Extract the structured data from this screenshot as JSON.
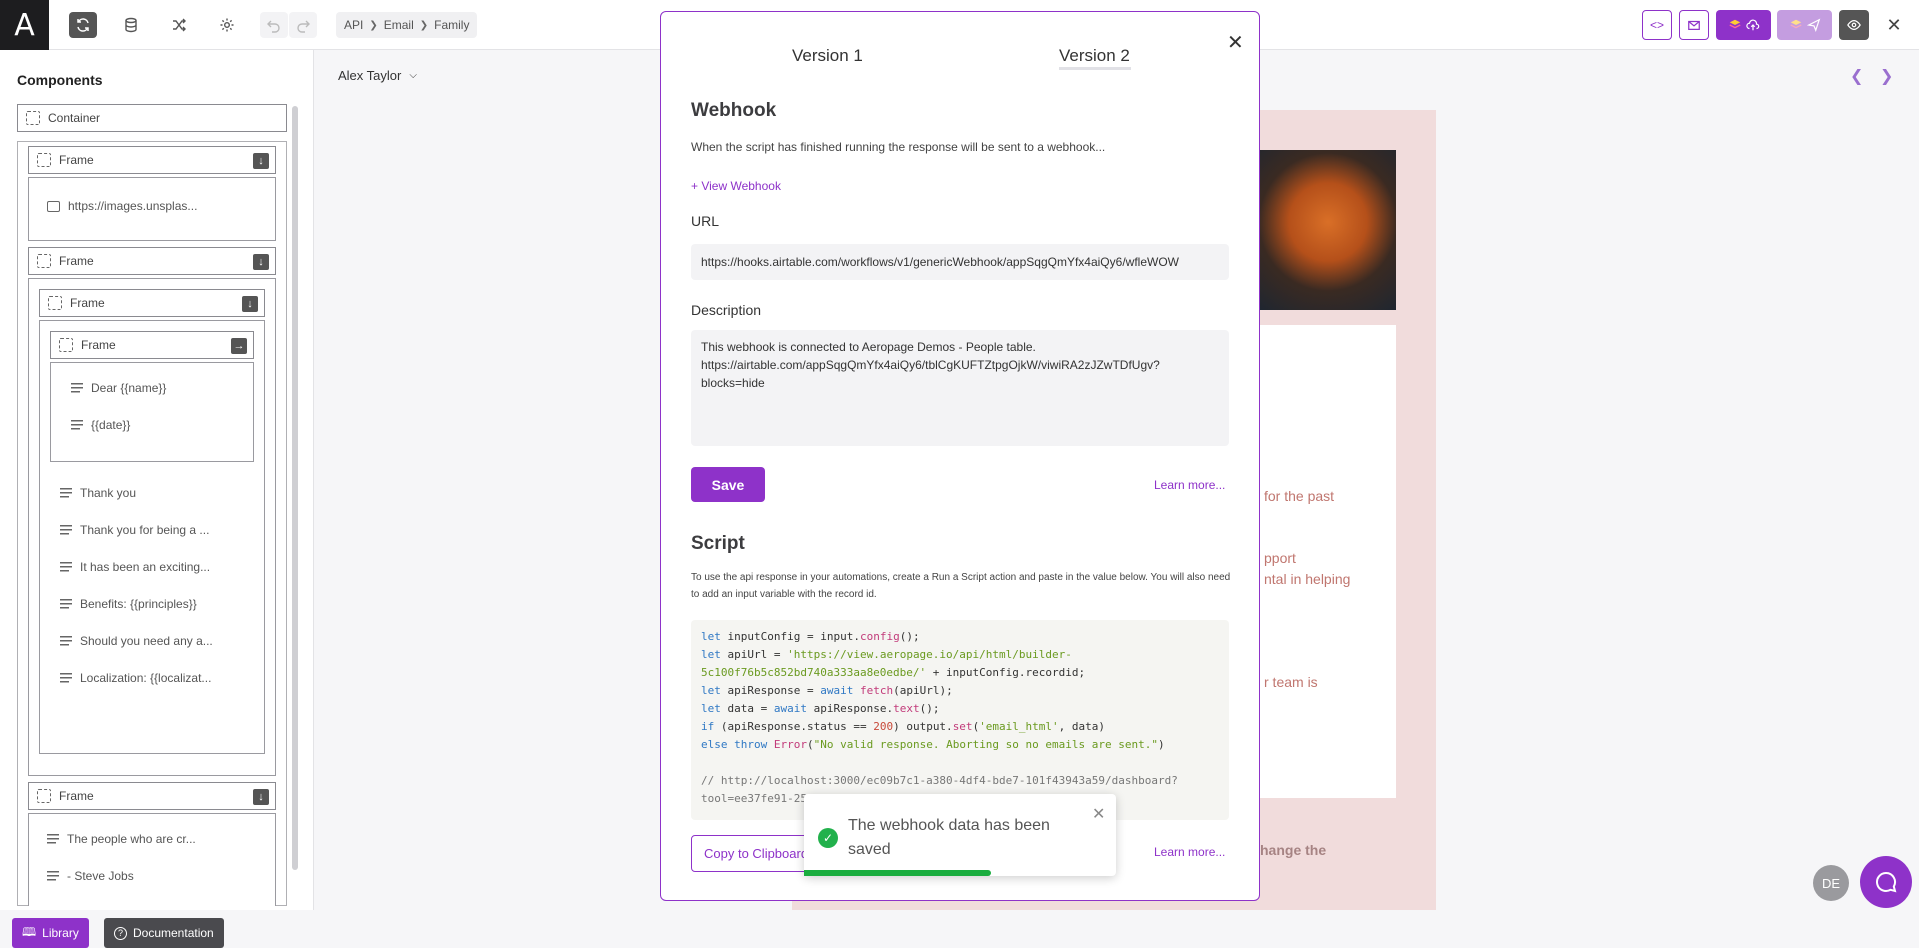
{
  "topbar": {
    "logo_icon": "aeropage-logo-icon",
    "breadcrumb": [
      "API",
      "Email",
      "Family"
    ]
  },
  "left_panel": {
    "title": "Components",
    "tree": {
      "container": "Container",
      "frame1": "Frame",
      "image": "https://images.unsplas...",
      "frame2": "Frame",
      "frame3": "Frame",
      "frame4": "Frame",
      "dear": "Dear {{name}}",
      "date": "{{date}}",
      "items": [
        "Thank you",
        "Thank you for being a ...",
        "It has been an exciting...",
        "Benefits: {{principles}}",
        "Should you need any a...",
        "Localization: {{localizat..."
      ],
      "frame5": "Frame",
      "people": "The people who are cr...",
      "jobs": "- Steve Jobs"
    },
    "library_label": "Library",
    "documentation_label": "Documentation"
  },
  "user_dropdown": "Alex Taylor",
  "preview": {
    "text1": "for the past",
    "text2": "pport",
    "text3": "ntal in helping",
    "text4": "r team is",
    "bottom": "hange the"
  },
  "modal": {
    "tab1": "Version 1",
    "tab2": "Version 2",
    "webhook_title": "Webhook",
    "webhook_desc": "When the script has finished running the response will be sent to a webhook...",
    "view_webhook": "+ View Webhook",
    "url_label": "URL",
    "url_value": "https://hooks.airtable.com/workflows/v1/genericWebhook/appSqgQmYfx4aiQy6/wfleWOW",
    "desc_label": "Description",
    "desc_value": "This webhook is connected to Aeropage Demos - People table.\nhttps://airtable.com/appSqgQmYfx4aiQy6/tblCgKUFTZtpgOjkW/viwiRA2zJZwTDfUgv?\nblocks=hide",
    "save_label": "Save",
    "learn_more": "Learn more...",
    "script_title": "Script",
    "script_desc": "To use the api response in your automations, create a Run a Script action and paste in the value below. You will also need to add an input variable with the record id.",
    "code_comment": "// http://localhost:3000/ec09b7c1-a380-4df4-bde7-101f43943a59/dashboard?",
    "code_comment2": "tool=ee37fe91-2557-4888-ba7b-a9d457b2437b",
    "copy_label": "Copy to Clipboard",
    "learn_more2": "Learn more..."
  },
  "toast": {
    "message": "The webhook data has been saved",
    "progress": 0.6
  },
  "avatar_initials": "DE",
  "colors": {
    "accent": "#8e32c9",
    "success": "#22b14c"
  }
}
